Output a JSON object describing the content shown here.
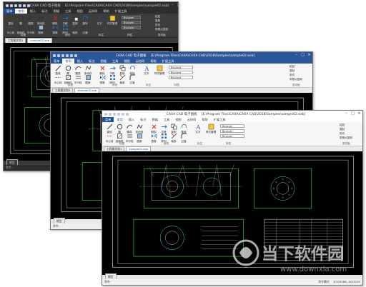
{
  "app_title": "CAXA CAD 电子图板",
  "windows": [
    {
      "file_path": "[E:\\Program Files\\CAXA\\CAXA CAD\\2018\\Samples\\sample02.exb]",
      "ribbon_tabs": [
        "菜单",
        "常用",
        "插入",
        "标注",
        "图幅",
        "工具",
        "视图",
        "云协同",
        "帮助",
        "扩展工具"
      ],
      "active_tab_index": 1,
      "draw_tools": [
        "直线",
        "圆",
        "圆弧",
        "多段线",
        "中心线",
        "剖面线",
        "平行线",
        "图案"
      ],
      "modify_tools": [
        "删除",
        "平移",
        "复制",
        "旋转",
        "镜像",
        "阵列",
        "裁剪",
        "过渡"
      ],
      "style_label": "样式管理",
      "text_label": "文字",
      "layer_combo": "ByLayer",
      "group_labels": [
        "绘图",
        "修改",
        "标注",
        "特性",
        "剪切板"
      ],
      "clipboard": [
        "粘贴",
        "复制",
        "剪切",
        "带基点复制"
      ],
      "doc_tabs": [
        "工程图文档1",
        "sample02.exb"
      ],
      "status_left": "命令:",
      "status_coords": "",
      "status_right": "",
      "model_tab": "模型",
      "theme": "dark"
    },
    {
      "file_path": "[E:\\Program Files\\CAXA\\CAXA CAD\\2018\\Samples\\sample02.exb]",
      "ribbon_tabs": [
        "菜单",
        "常用",
        "插入",
        "标注",
        "图幅",
        "工具",
        "视图",
        "云协同",
        "帮助",
        "扩展工具"
      ],
      "active_tab_index": 1,
      "draw_tools": [
        "直线",
        "圆",
        "圆弧",
        "多段线",
        "中心线",
        "剖面线",
        "平行线",
        "图案"
      ],
      "modify_tools": [
        "删除",
        "平移",
        "复制",
        "旋转",
        "镜像",
        "阵列",
        "裁剪",
        "过渡"
      ],
      "style_label": "样式管理",
      "text_label": "文字",
      "layer_combo": "ByLayer",
      "group_labels": [
        "绘图",
        "修改",
        "标注",
        "特性",
        "剪切板"
      ],
      "clipboard": [
        "粘贴",
        "复制",
        "剪切",
        "带基点复制"
      ],
      "doc_tabs": [
        "工程图文档1",
        "sample02.exb"
      ],
      "status_left": "命令:",
      "status_coords": "",
      "status_right": "",
      "model_tab": "模型",
      "theme": "blue"
    },
    {
      "file_path": "[E:\\Program Files\\CAXA\\CAXA CAD\\2018\\Samples\\sample02.exb]",
      "ribbon_tabs": [
        "菜单",
        "常用",
        "插入",
        "标注",
        "图幅",
        "工具",
        "视图",
        "云协同",
        "帮助",
        "扩展工具"
      ],
      "active_tab_index": 1,
      "draw_tools": [
        "直线",
        "圆",
        "圆弧",
        "多段线",
        "中心线",
        "剖面线",
        "平行线",
        "图案"
      ],
      "modify_tools": [
        "删除",
        "平移",
        "复制",
        "旋转",
        "镜像",
        "阵列",
        "裁剪",
        "过渡"
      ],
      "style_label": "样式管理",
      "text_label": "文字",
      "layer_combo": "ByLayer",
      "group_labels": [
        "绘图",
        "修改",
        "标注",
        "特性",
        "剪切板"
      ],
      "clipboard": [
        "粘贴",
        "复制",
        "剪切",
        "带基点复制"
      ],
      "doc_tabs": [
        "工程图文档1",
        "sample02.exb"
      ],
      "status_left": "命令:",
      "status_coords": "8.503286, 4415133",
      "status_right": "命令模式",
      "model_tab": "模型",
      "theme": "light"
    }
  ],
  "watermark": {
    "brand": "当下软件园",
    "url": "www.downxia.com"
  },
  "colors": {
    "dark_chrome": "#2d2d30",
    "blue_chrome": "#2b579a",
    "light_chrome": "#ffffff",
    "cad_line_cyan": "#41d7e6",
    "cad_line_green": "#3ee43e",
    "cad_line_yellow": "#e6e640",
    "cad_line_white": "#e8e8e8"
  }
}
